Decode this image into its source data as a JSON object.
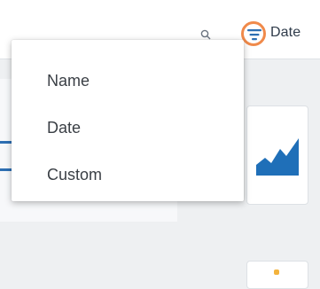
{
  "toolbar": {
    "sort_label": "Date",
    "search_icon": "search-icon",
    "sort_icon": "sort-lines-icon",
    "highlight_color": "#f08a4b",
    "sort_icon_color": "#2d6fb3"
  },
  "sort_menu": {
    "items": [
      {
        "label": "Name"
      },
      {
        "label": "Date"
      },
      {
        "label": "Custom"
      }
    ]
  },
  "tiles": [
    {
      "icon": "area-chart-icon",
      "color": "#1f6fb8"
    },
    {
      "icon": "tile-icon",
      "color": "#f3b33d"
    }
  ]
}
